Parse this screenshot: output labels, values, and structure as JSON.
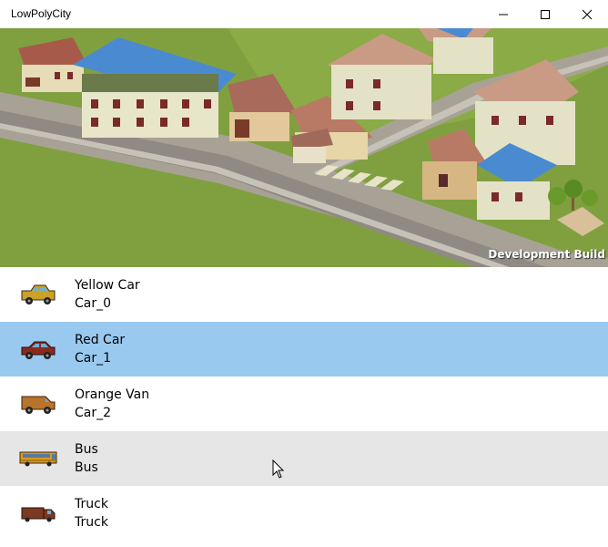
{
  "window": {
    "title": "LowPolyCity",
    "icons": [
      "minimize-icon",
      "maximize-icon",
      "close-icon"
    ]
  },
  "viewport": {
    "overlay_text": "Development Build"
  },
  "vehicles": [
    {
      "name": "Yellow Car",
      "id": "Car_0",
      "icon": "yellow-car-icon",
      "color": "#c9a227",
      "background": "#ffffff",
      "selected": false
    },
    {
      "name": "Red Car",
      "id": "Car_1",
      "icon": "red-car-icon",
      "color": "#8b2a1c",
      "background": "#99c9ef",
      "selected": true
    },
    {
      "name": "Orange Van",
      "id": "Car_2",
      "icon": "orange-van-icon",
      "color": "#b8742a",
      "background": "#ffffff",
      "selected": false
    },
    {
      "name": "Bus",
      "id": "Bus",
      "icon": "bus-icon",
      "color": "#d99a22",
      "background": "#e6e6e6",
      "selected": false
    },
    {
      "name": "Truck",
      "id": "Truck",
      "icon": "truck-icon",
      "color": "#7a3a22",
      "background": "#ffffff",
      "selected": false
    }
  ]
}
